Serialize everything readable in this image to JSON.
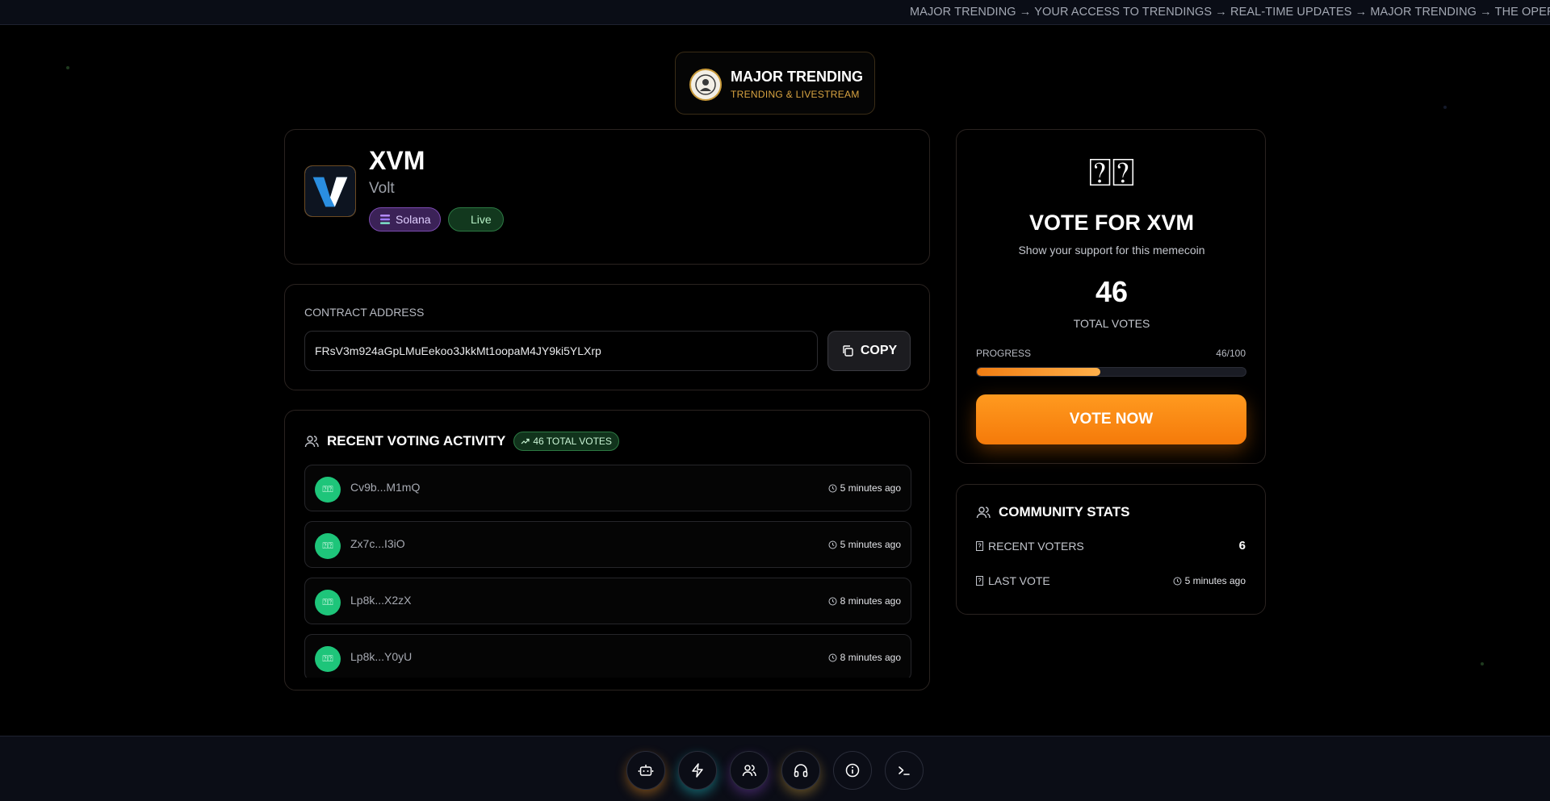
{
  "ticker": {
    "text": "MAJOR TRENDING → YOUR ACCESS TO TRENDINGS → REAL-TIME UPDATES → MAJOR TRENDING → THE OPERATING S"
  },
  "brand": {
    "title": "MAJOR TRENDING",
    "subtitle": "TRENDING & LIVESTREAM"
  },
  "token": {
    "symbol": "XVM",
    "name": "Volt",
    "chain_badge": "Solana",
    "status_badge": "Live"
  },
  "contract": {
    "label": "CONTRACT ADDRESS",
    "address": "FRsV3m924aGpLMuEekoo3JkkMt1oopaM4JY9ki5YLXrp",
    "copy_label": "COPY"
  },
  "activity": {
    "title": "RECENT VOTING ACTIVITY",
    "total_badge": "46 TOTAL VOTES",
    "rows": [
      {
        "avatar": "⍰⍰",
        "address": "Cv9b...M1mQ",
        "time": "5 minutes ago"
      },
      {
        "avatar": "⍰⍰",
        "address": "Zx7c...I3iO",
        "time": "5 minutes ago"
      },
      {
        "avatar": "⍰⍰",
        "address": "Lp8k...X2zX",
        "time": "8 minutes ago"
      },
      {
        "avatar": "⍰⍰",
        "address": "Lp8k...Y0yU",
        "time": "8 minutes ago"
      }
    ]
  },
  "vote": {
    "icon_text": "⍰⍰",
    "title": "VOTE FOR XVM",
    "subtitle": "Show your support for this memecoin",
    "count": "46",
    "count_label": "TOTAL VOTES",
    "progress_label": "PROGRESS",
    "progress_value": "46/100",
    "progress_fraction": 0.46,
    "button_label": "VOTE NOW"
  },
  "stats": {
    "title": "COMMUNITY STATS",
    "recent_voters_label": "RECENT VOTERS",
    "recent_voters_value": "6",
    "last_vote_label": "LAST VOTE",
    "last_vote_value": "5 minutes ago"
  },
  "bottom_nav": {
    "icons": [
      "robot-icon",
      "lightning-icon",
      "users-icon",
      "headphones-icon",
      "info-icon",
      "terminal-icon"
    ]
  },
  "colors": {
    "accent_orange": "#f57a0a",
    "success_green": "#1ec57a",
    "solana_purple": "#7b4bb0"
  }
}
